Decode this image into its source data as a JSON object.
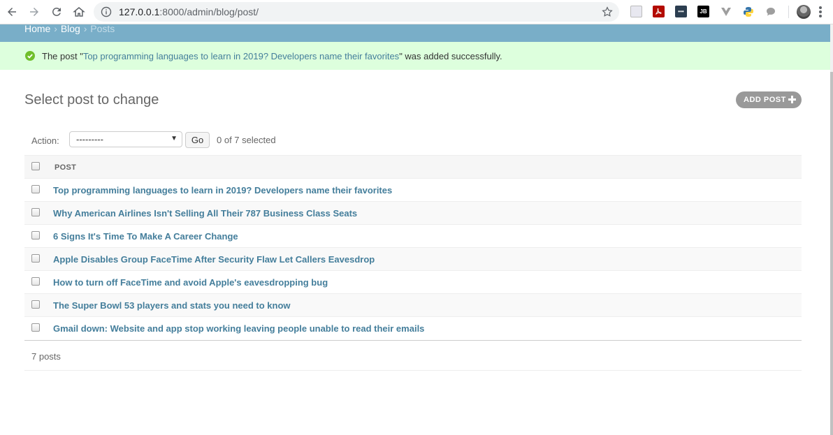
{
  "browser": {
    "url_host": "127.0.0.1",
    "url_rest": ":8000/admin/blog/post/"
  },
  "breadcrumbs": {
    "home": "Home",
    "app": "Blog",
    "current": "Posts",
    "separator": "›"
  },
  "message": {
    "prefix": "The post \"",
    "link": "Top programming languages to learn in 2019? Developers name their favorites",
    "suffix": "\" was added successfully."
  },
  "page": {
    "title": "Select post to change",
    "add_button": "ADD POST"
  },
  "actions": {
    "label": "Action:",
    "selected_option": "---------",
    "go_label": "Go",
    "selected_count": "0 of 7 selected"
  },
  "table": {
    "column_header": "POST",
    "rows": [
      "Top programming languages to learn in 2019? Developers name their favorites",
      "Why American Airlines Isn't Selling All Their 787 Business Class Seats",
      "6 Signs It's Time To Make A Career Change",
      "Apple Disables Group FaceTime After Security Flaw Let Callers Eavesdrop",
      "How to turn off FaceTime and avoid Apple's eavesdropping bug",
      "The Super Bowl 53 players and stats you need to know",
      "Gmail down: Website and app stop working leaving people unable to read their emails"
    ]
  },
  "paginator": {
    "count_text": "7 posts"
  },
  "colors": {
    "header_bg": "#79aec8",
    "success_bg": "#ddffdd",
    "link": "#447e9b",
    "success_icon": "#70bf2b"
  },
  "extensions": [
    "bookmark-icon",
    "pdf-icon",
    "dots-icon",
    "jetbrains-icon",
    "vue-icon",
    "python-icon",
    "speech-bubble-icon"
  ]
}
